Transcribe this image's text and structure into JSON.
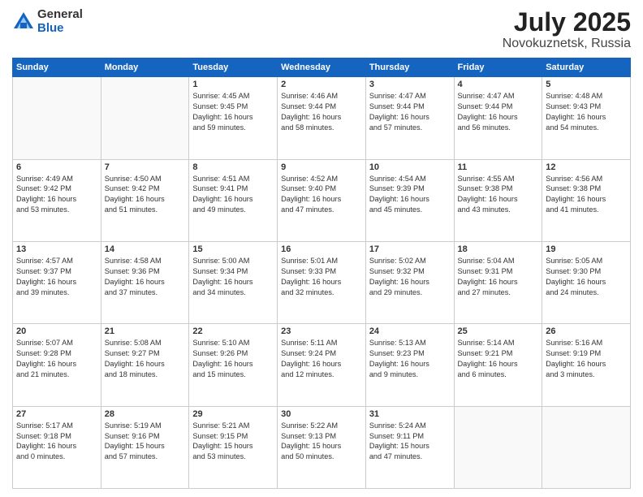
{
  "logo": {
    "general": "General",
    "blue": "Blue"
  },
  "header": {
    "month_year": "July 2025",
    "location": "Novokuznetsk, Russia"
  },
  "weekdays": [
    "Sunday",
    "Monday",
    "Tuesday",
    "Wednesday",
    "Thursday",
    "Friday",
    "Saturday"
  ],
  "weeks": [
    [
      {
        "day": "",
        "info": ""
      },
      {
        "day": "",
        "info": ""
      },
      {
        "day": "1",
        "info": "Sunrise: 4:45 AM\nSunset: 9:45 PM\nDaylight: 16 hours\nand 59 minutes."
      },
      {
        "day": "2",
        "info": "Sunrise: 4:46 AM\nSunset: 9:44 PM\nDaylight: 16 hours\nand 58 minutes."
      },
      {
        "day": "3",
        "info": "Sunrise: 4:47 AM\nSunset: 9:44 PM\nDaylight: 16 hours\nand 57 minutes."
      },
      {
        "day": "4",
        "info": "Sunrise: 4:47 AM\nSunset: 9:44 PM\nDaylight: 16 hours\nand 56 minutes."
      },
      {
        "day": "5",
        "info": "Sunrise: 4:48 AM\nSunset: 9:43 PM\nDaylight: 16 hours\nand 54 minutes."
      }
    ],
    [
      {
        "day": "6",
        "info": "Sunrise: 4:49 AM\nSunset: 9:42 PM\nDaylight: 16 hours\nand 53 minutes."
      },
      {
        "day": "7",
        "info": "Sunrise: 4:50 AM\nSunset: 9:42 PM\nDaylight: 16 hours\nand 51 minutes."
      },
      {
        "day": "8",
        "info": "Sunrise: 4:51 AM\nSunset: 9:41 PM\nDaylight: 16 hours\nand 49 minutes."
      },
      {
        "day": "9",
        "info": "Sunrise: 4:52 AM\nSunset: 9:40 PM\nDaylight: 16 hours\nand 47 minutes."
      },
      {
        "day": "10",
        "info": "Sunrise: 4:54 AM\nSunset: 9:39 PM\nDaylight: 16 hours\nand 45 minutes."
      },
      {
        "day": "11",
        "info": "Sunrise: 4:55 AM\nSunset: 9:38 PM\nDaylight: 16 hours\nand 43 minutes."
      },
      {
        "day": "12",
        "info": "Sunrise: 4:56 AM\nSunset: 9:38 PM\nDaylight: 16 hours\nand 41 minutes."
      }
    ],
    [
      {
        "day": "13",
        "info": "Sunrise: 4:57 AM\nSunset: 9:37 PM\nDaylight: 16 hours\nand 39 minutes."
      },
      {
        "day": "14",
        "info": "Sunrise: 4:58 AM\nSunset: 9:36 PM\nDaylight: 16 hours\nand 37 minutes."
      },
      {
        "day": "15",
        "info": "Sunrise: 5:00 AM\nSunset: 9:34 PM\nDaylight: 16 hours\nand 34 minutes."
      },
      {
        "day": "16",
        "info": "Sunrise: 5:01 AM\nSunset: 9:33 PM\nDaylight: 16 hours\nand 32 minutes."
      },
      {
        "day": "17",
        "info": "Sunrise: 5:02 AM\nSunset: 9:32 PM\nDaylight: 16 hours\nand 29 minutes."
      },
      {
        "day": "18",
        "info": "Sunrise: 5:04 AM\nSunset: 9:31 PM\nDaylight: 16 hours\nand 27 minutes."
      },
      {
        "day": "19",
        "info": "Sunrise: 5:05 AM\nSunset: 9:30 PM\nDaylight: 16 hours\nand 24 minutes."
      }
    ],
    [
      {
        "day": "20",
        "info": "Sunrise: 5:07 AM\nSunset: 9:28 PM\nDaylight: 16 hours\nand 21 minutes."
      },
      {
        "day": "21",
        "info": "Sunrise: 5:08 AM\nSunset: 9:27 PM\nDaylight: 16 hours\nand 18 minutes."
      },
      {
        "day": "22",
        "info": "Sunrise: 5:10 AM\nSunset: 9:26 PM\nDaylight: 16 hours\nand 15 minutes."
      },
      {
        "day": "23",
        "info": "Sunrise: 5:11 AM\nSunset: 9:24 PM\nDaylight: 16 hours\nand 12 minutes."
      },
      {
        "day": "24",
        "info": "Sunrise: 5:13 AM\nSunset: 9:23 PM\nDaylight: 16 hours\nand 9 minutes."
      },
      {
        "day": "25",
        "info": "Sunrise: 5:14 AM\nSunset: 9:21 PM\nDaylight: 16 hours\nand 6 minutes."
      },
      {
        "day": "26",
        "info": "Sunrise: 5:16 AM\nSunset: 9:19 PM\nDaylight: 16 hours\nand 3 minutes."
      }
    ],
    [
      {
        "day": "27",
        "info": "Sunrise: 5:17 AM\nSunset: 9:18 PM\nDaylight: 16 hours\nand 0 minutes."
      },
      {
        "day": "28",
        "info": "Sunrise: 5:19 AM\nSunset: 9:16 PM\nDaylight: 15 hours\nand 57 minutes."
      },
      {
        "day": "29",
        "info": "Sunrise: 5:21 AM\nSunset: 9:15 PM\nDaylight: 15 hours\nand 53 minutes."
      },
      {
        "day": "30",
        "info": "Sunrise: 5:22 AM\nSunset: 9:13 PM\nDaylight: 15 hours\nand 50 minutes."
      },
      {
        "day": "31",
        "info": "Sunrise: 5:24 AM\nSunset: 9:11 PM\nDaylight: 15 hours\nand 47 minutes."
      },
      {
        "day": "",
        "info": ""
      },
      {
        "day": "",
        "info": ""
      }
    ]
  ]
}
